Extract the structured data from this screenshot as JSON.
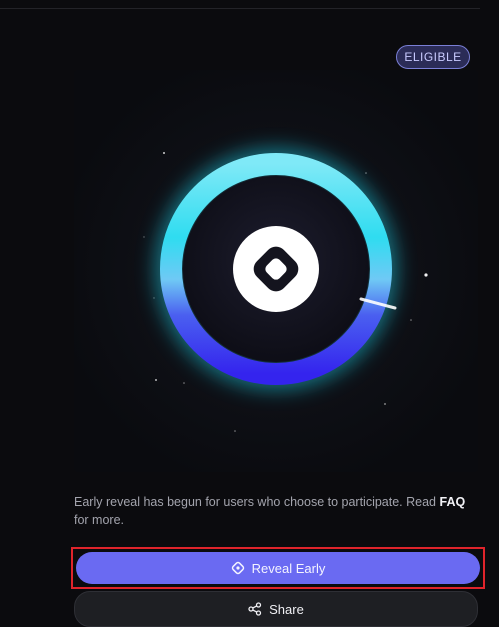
{
  "badge": {
    "label": "ELIGIBLE"
  },
  "description": {
    "text_before": "Early reveal has begun for users who choose to participate. Read ",
    "link_text": "FAQ",
    "text_after": " for more."
  },
  "actions": {
    "reveal_label": "Reveal Early",
    "share_label": "Share"
  },
  "icons": {
    "reveal": "reveal-icon",
    "share": "share-icon",
    "logo": "diamond-logo-icon"
  },
  "colors": {
    "accent": "#6a6af2",
    "ring_cyan": "#1fd8ee",
    "ring_blue": "#3b2df0",
    "badge_border": "#7a7fd6",
    "highlight": "#e0242b"
  }
}
